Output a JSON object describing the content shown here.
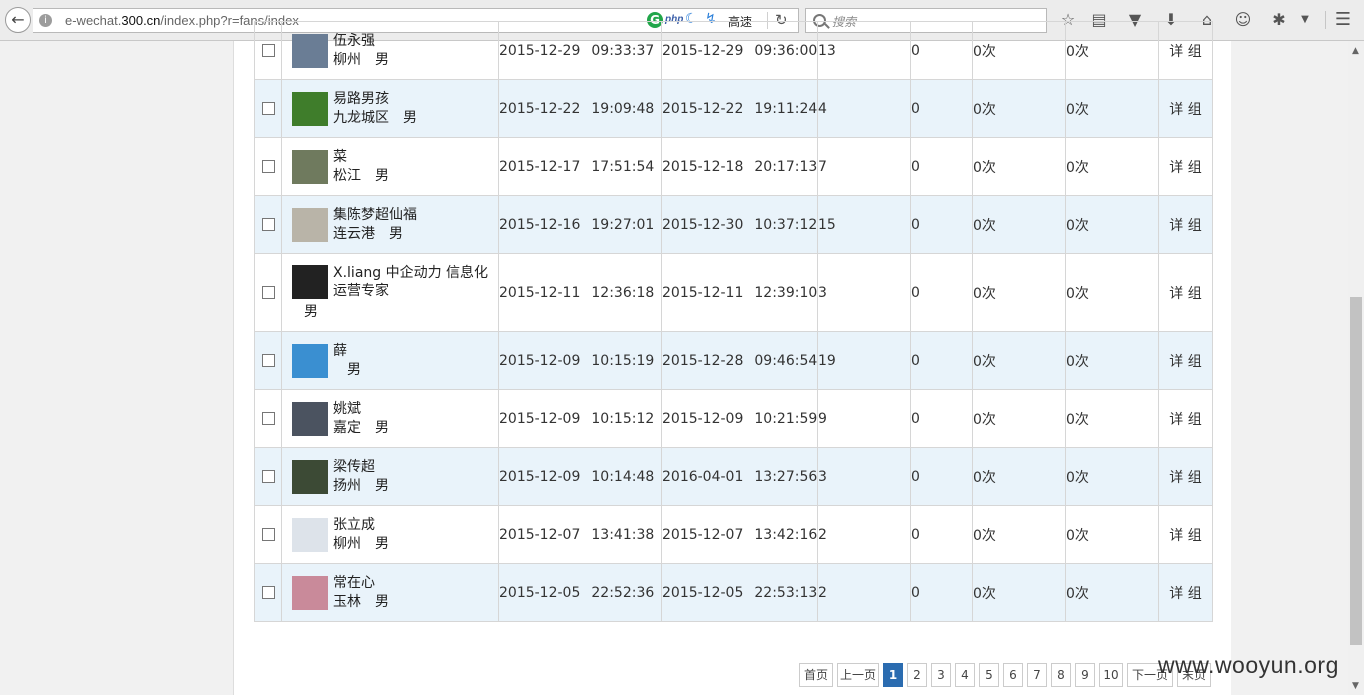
{
  "browser": {
    "url_prefix": "e-wechat.",
    "url_host": "300.cn",
    "url_path": "/index.php?r=fans/index",
    "ext_php": "php",
    "ext_speed_label": "高速",
    "search_placeholder": "搜索"
  },
  "rows": [
    {
      "name": "伍永强",
      "location": "柳州",
      "gender": "男",
      "sub_date": "2015-12-29",
      "sub_time": "09:33:37",
      "last_date": "2015-12-29",
      "last_time": "09:36:00",
      "msgs": "13",
      "c1": "0",
      "c2": "0次",
      "c3": "0次",
      "alt": false,
      "avatar": "#6a7d95"
    },
    {
      "name": "易路男孩",
      "location": "九龙城区",
      "gender": "男",
      "sub_date": "2015-12-22",
      "sub_time": "19:09:48",
      "last_date": "2015-12-22",
      "last_time": "19:11:24",
      "msgs": "4",
      "c1": "0",
      "c2": "0次",
      "c3": "0次",
      "alt": true,
      "avatar": "#3f7d2b"
    },
    {
      "name": "菜",
      "location": "松江",
      "gender": "男",
      "sub_date": "2015-12-17",
      "sub_time": "17:51:54",
      "last_date": "2015-12-18",
      "last_time": "20:17:13",
      "msgs": "7",
      "c1": "0",
      "c2": "0次",
      "c3": "0次",
      "alt": false,
      "avatar": "#6f7a5e"
    },
    {
      "name": "集陈梦超仙福",
      "location": "连云港",
      "gender": "男",
      "sub_date": "2015-12-16",
      "sub_time": "19:27:01",
      "last_date": "2015-12-30",
      "last_time": "10:37:12",
      "msgs": "15",
      "c1": "0",
      "c2": "0次",
      "c3": "0次",
      "alt": true,
      "avatar": "#b9b4a8"
    },
    {
      "name": "X.liang 中企动力 信息化运营专家",
      "location": "",
      "gender": "男",
      "sub_date": "2015-12-11",
      "sub_time": "12:36:18",
      "last_date": "2015-12-11",
      "last_time": "12:39:10",
      "msgs": "3",
      "c1": "0",
      "c2": "0次",
      "c3": "0次",
      "alt": false,
      "avatar": "#222222"
    },
    {
      "name": "薛",
      "location": "",
      "gender": "男",
      "sub_date": "2015-12-09",
      "sub_time": "10:15:19",
      "last_date": "2015-12-28",
      "last_time": "09:46:54",
      "msgs": "19",
      "c1": "0",
      "c2": "0次",
      "c3": "0次",
      "alt": true,
      "avatar": "#3a8fd1"
    },
    {
      "name": "姚斌",
      "location": "嘉定",
      "gender": "男",
      "sub_date": "2015-12-09",
      "sub_time": "10:15:12",
      "last_date": "2015-12-09",
      "last_time": "10:21:59",
      "msgs": "9",
      "c1": "0",
      "c2": "0次",
      "c3": "0次",
      "alt": false,
      "avatar": "#4b5360"
    },
    {
      "name": "梁传超",
      "location": "扬州",
      "gender": "男",
      "sub_date": "2015-12-09",
      "sub_time": "10:14:48",
      "last_date": "2016-04-01",
      "last_time": "13:27:56",
      "msgs": "3",
      "c1": "0",
      "c2": "0次",
      "c3": "0次",
      "alt": true,
      "avatar": "#3c4a35"
    },
    {
      "name": "张立成",
      "location": "柳州",
      "gender": "男",
      "sub_date": "2015-12-07",
      "sub_time": "13:41:38",
      "last_date": "2015-12-07",
      "last_time": "13:42:16",
      "msgs": "2",
      "c1": "0",
      "c2": "0次",
      "c3": "0次",
      "alt": false,
      "avatar": "#dde3ea"
    },
    {
      "name": "常在心",
      "location": "玉林",
      "gender": "男",
      "sub_date": "2015-12-05",
      "sub_time": "22:52:36",
      "last_date": "2015-12-05",
      "last_time": "22:53:13",
      "msgs": "2",
      "c1": "0",
      "c2": "0次",
      "c3": "0次",
      "alt": true,
      "avatar": "#c98a9a"
    }
  ],
  "row_actions": {
    "detail": "详",
    "group": "组"
  },
  "pagination": {
    "first": "首页",
    "prev": "上一页",
    "pages": [
      "1",
      "2",
      "3",
      "4",
      "5",
      "6",
      "7",
      "8",
      "9",
      "10"
    ],
    "active": "1",
    "next": "下一页",
    "last": "末页"
  },
  "watermark": "www.wooyun.org"
}
